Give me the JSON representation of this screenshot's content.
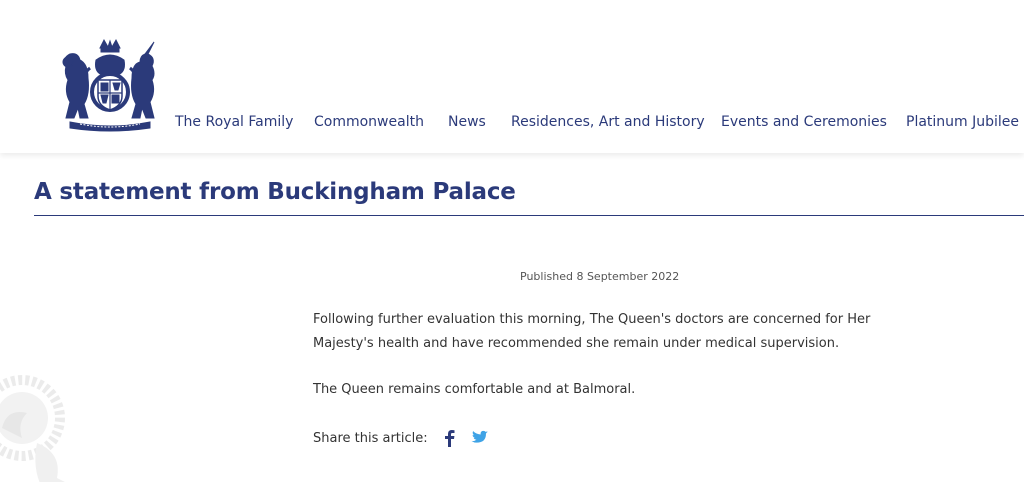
{
  "nav": {
    "items": [
      "The Royal Family",
      "Commonwealth",
      "News",
      "Residences, Art and History",
      "Events and Ceremonies",
      "Platinum Jubilee"
    ]
  },
  "article": {
    "title": "A statement from Buckingham Palace",
    "published": "Published 8 September 2022",
    "paragraphs": [
      "Following further evaluation this morning, The Queen's doctors are concerned for Her Majesty's health and have recommended she remain under medical supervision.",
      "The Queen remains comfortable and at Balmoral."
    ],
    "share_label": "Share this article:"
  },
  "colors": {
    "brand_navy": "#2b3a7a",
    "facebook": "#2b3a7a",
    "twitter": "#3fa3e6"
  },
  "icons": {
    "crest": "royal-coat-of-arms-icon",
    "facebook": "facebook-icon",
    "twitter": "twitter-icon"
  }
}
